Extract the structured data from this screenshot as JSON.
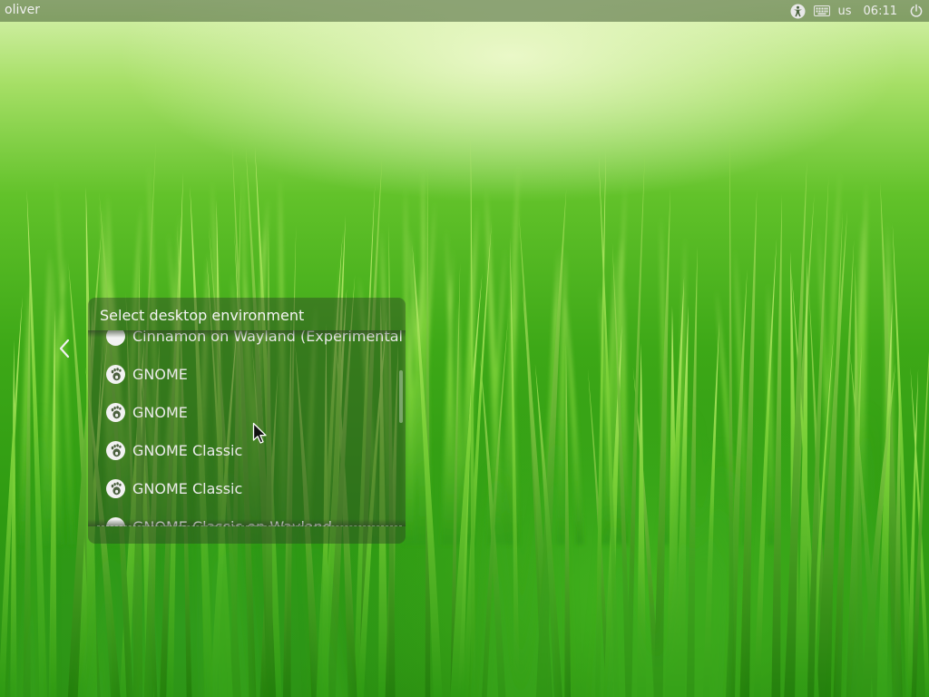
{
  "top_panel": {
    "username": "oliver",
    "keyboard_layout": "us",
    "clock": "06:11",
    "icons": [
      "accessibility-icon",
      "keyboard-icon",
      "power-icon"
    ]
  },
  "session_selector": {
    "title": "Select desktop environment",
    "items": [
      {
        "label": "Cinnamon on Wayland (Experimental)",
        "icon": "session-icon"
      },
      {
        "label": "GNOME",
        "icon": "gnome-foot-icon"
      },
      {
        "label": "GNOME",
        "icon": "gnome-foot-icon"
      },
      {
        "label": "GNOME Classic",
        "icon": "gnome-foot-icon"
      },
      {
        "label": "GNOME Classic",
        "icon": "gnome-foot-icon"
      },
      {
        "label": "GNOME Classic on Wayland",
        "icon": "session-icon"
      }
    ]
  },
  "colors": {
    "panel_bg": "#465f37",
    "text": "#f4f4f4"
  }
}
